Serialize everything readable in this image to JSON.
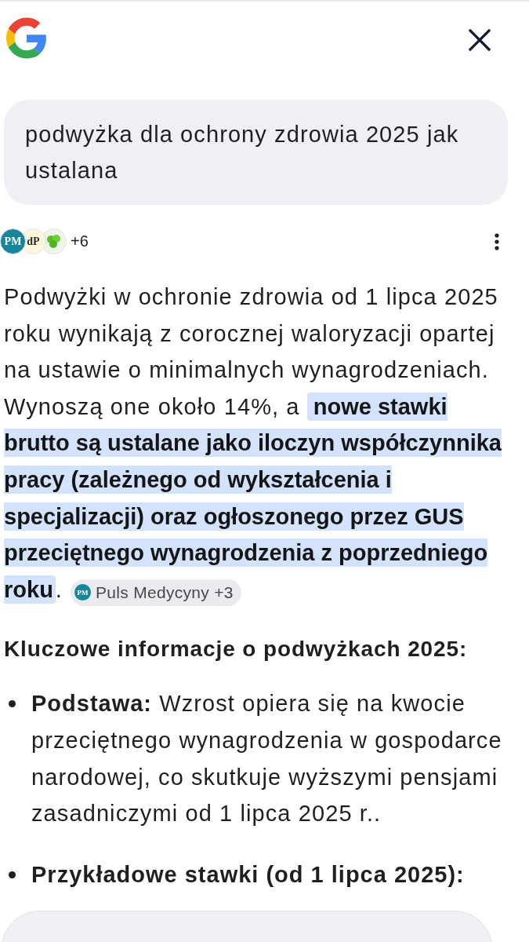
{
  "query": {
    "text": "podwyżka dla ochrony zdrowia 2025 jak ustalana"
  },
  "sources": {
    "logos": [
      {
        "kind": "initials",
        "initials": "PM",
        "color": "#17869a"
      },
      {
        "kind": "initials",
        "initials": "dP",
        "color": "#fbf6dc"
      },
      {
        "kind": "leaf",
        "color": "#eef6e8"
      }
    ],
    "more": "+6"
  },
  "answer": {
    "segments": [
      {
        "text": "Podwyżki w ochronie zdrowia od 1 lipca 2025 roku wynikają z corocznej waloryzacji opartej na ustawie o minimalnych wynagrodzeniach. Wynoszą one około 14%, a ",
        "highlighted": false
      },
      {
        "text": "nowe stawki brutto są ustalane jako iloczyn współczynnika pracy (zależnego od wykształcenia i specjalizacji) oraz ogłoszonego przez GUS przeciętnego wynagrodzenia z poprzedniego roku",
        "highlighted": true
      },
      {
        "text": ".",
        "highlighted": false
      }
    ],
    "citation": {
      "icon_initials": "PM",
      "label": "Puls Medycyny +3"
    }
  },
  "heading": "Kluczowe informacje o podwyżkach 2025:",
  "bullets": [
    {
      "label": "Podstawa:",
      "text": "Wzrost opiera się na kwocie przeciętnego wynagrodzenia w gospodarce narodowej, co skutkuje wyższymi pensjami zasadniczymi od 1 lipca 2025 r.."
    },
    {
      "label": "Przykładowe stawki (od 1 lipca 2025):"
    }
  ]
}
